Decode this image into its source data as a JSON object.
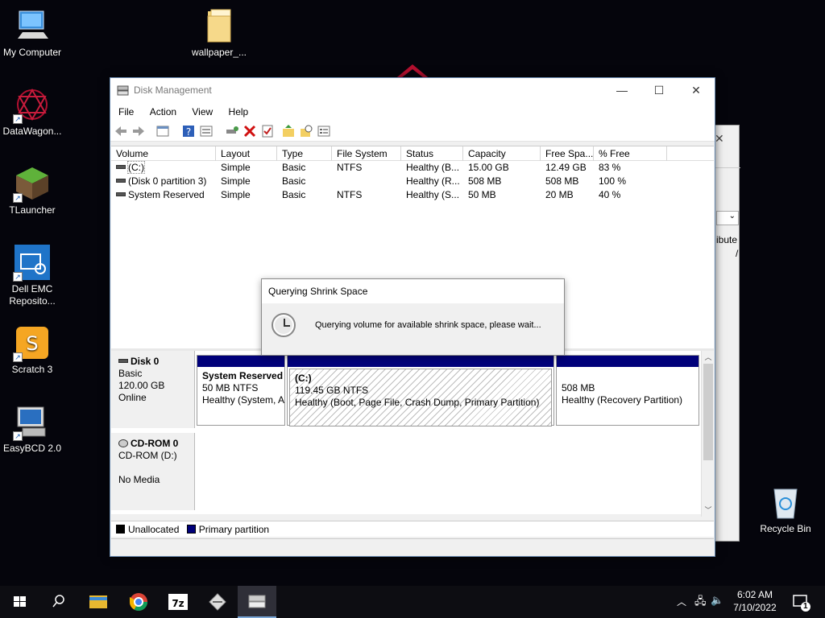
{
  "desktop": {
    "icons": [
      {
        "label": "My Computer",
        "icon": "computer-icon"
      },
      {
        "label": "wallpaper_...",
        "icon": "folder-icon"
      },
      {
        "label": "DataWagon...",
        "icon": "datawagon-icon"
      },
      {
        "label": "TLauncher",
        "icon": "minecraft-block-icon"
      },
      {
        "label": "Dell EMC\nReposito...",
        "icon": "dell-emc-icon"
      },
      {
        "label": "Scratch 3",
        "icon": "scratch-icon"
      },
      {
        "label": "EasyBCD 2.0",
        "icon": "easybcd-icon"
      },
      {
        "label": "Recycle Bin",
        "icon": "recycle-bin-icon"
      }
    ]
  },
  "window": {
    "title": "Disk Management",
    "menu": [
      "File",
      "Action",
      "View",
      "Help"
    ]
  },
  "volumes": {
    "columns": [
      "Volume",
      "Layout",
      "Type",
      "File System",
      "Status",
      "Capacity",
      "Free Spa...",
      "% Free"
    ],
    "rows": [
      [
        "(C:)",
        "Simple",
        "Basic",
        "NTFS",
        "Healthy (B...",
        "15.00 GB",
        "12.49 GB",
        "83 %"
      ],
      [
        "(Disk 0 partition 3)",
        "Simple",
        "Basic",
        "",
        "Healthy (R...",
        "508 MB",
        "508 MB",
        "100 %"
      ],
      [
        "System Reserved",
        "Simple",
        "Basic",
        "NTFS",
        "Healthy (S...",
        "50 MB",
        "20 MB",
        "40 %"
      ]
    ]
  },
  "disks": {
    "disk0": {
      "name": "Disk 0",
      "type": "Basic",
      "size": "120.00 GB",
      "state": "Online",
      "partitions": [
        {
          "name": "System Reserved",
          "size": "50 MB NTFS",
          "status": "Healthy (System, A"
        },
        {
          "name": "(C:)",
          "size": "119.45 GB NTFS",
          "status": "Healthy (Boot, Page File, Crash Dump, Primary Partition)"
        },
        {
          "name": "",
          "size": "508 MB",
          "status": "Healthy (Recovery Partition)"
        }
      ]
    },
    "cdrom": {
      "name": "CD-ROM 0",
      "type": "CD-ROM (D:)",
      "state": "No Media"
    }
  },
  "legend": {
    "unallocated": "Unallocated",
    "primary": "Primary partition",
    "unallocated_color": "#000000",
    "primary_color": "#00007a"
  },
  "dialog": {
    "title": "Querying Shrink Space",
    "message": "Querying volume for available shrink space, please wait..."
  },
  "back_window": {
    "text1": "ibute",
    "text2": "/"
  },
  "taskbar": {
    "time": "6:02 AM",
    "date": "7/10/2022",
    "notification_count": "1"
  }
}
